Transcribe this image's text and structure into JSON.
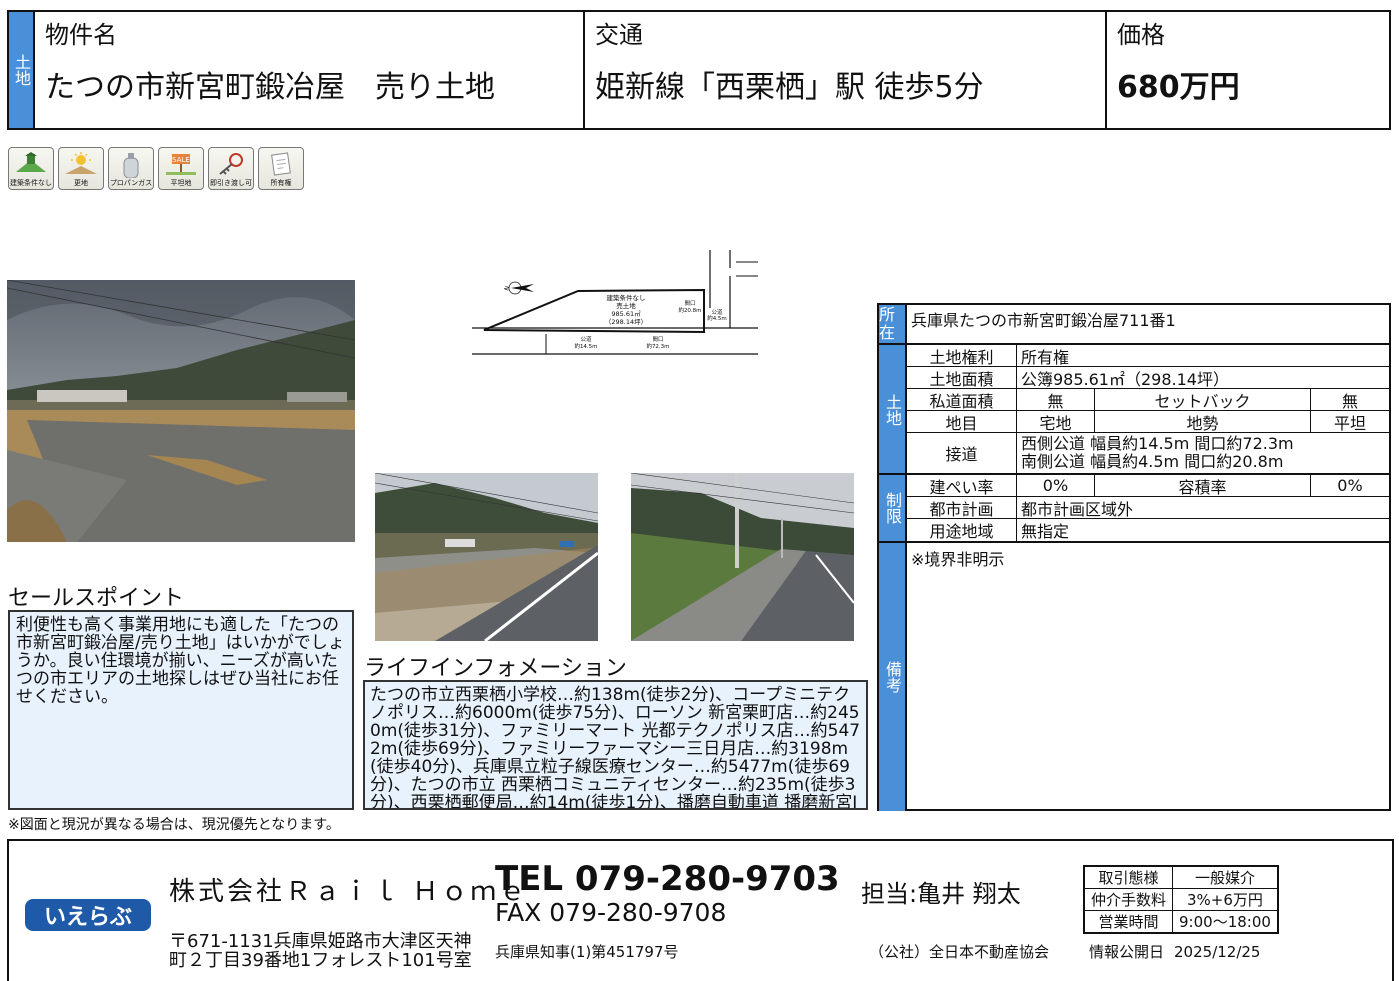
{
  "header": {
    "tag": "土地",
    "name_label": "物件名",
    "name_value": "たつの市新宮町鍛冶屋　売り土地",
    "access_label": "交通",
    "access_value": "姫新線「西栗栖」駅 徒歩5分",
    "price_label": "価格",
    "price_value": "680万円"
  },
  "badges": [
    {
      "icon": "land-icon",
      "label": "建築条件なし"
    },
    {
      "icon": "vacant-land-icon",
      "label": "更地"
    },
    {
      "icon": "gas-cylinder-icon",
      "label": "プロパンガス"
    },
    {
      "icon": "flat-land-sign-icon",
      "label": "平坦地"
    },
    {
      "icon": "key-icon",
      "label": "即引き渡し可"
    },
    {
      "icon": "document-icon",
      "label": "所有権"
    }
  ],
  "plan": {
    "lot_lines": [
      "建築条件なし",
      "売土地",
      "985.61㎡",
      "（298.14坪）"
    ],
    "frontage_top": "間口",
    "frontage_top_val": "約20.8m",
    "road_right": "公道",
    "road_right_val": "約4.5m",
    "road_bottom": "公道",
    "road_bottom_val": "約14.5m",
    "frontage_bottom": "間口",
    "frontage_bottom_val": "約72.3m",
    "north": "N"
  },
  "sales_point": {
    "title": "セールスポイント",
    "text": "利便性も高く事業用地にも適した「たつの市新宮町鍛冶屋/売り土地」はいかがでしょうか。良い住環境が揃い、ニーズが高いたつの市エリアの土地探しはぜひ当社にお任せください。"
  },
  "life_info": {
    "title": "ライフインフォメーション",
    "text": "たつの市立西栗栖小学校…約138m(徒歩2分)、コープミニテクノポリス…約6000m(徒歩75分)、ローソン 新宮栗町店…約2450m(徒歩31分)、ファミリーマート 光都テクノポリス店…約5472m(徒歩69分)、ファミリーファーマシー三日月店…約3198m(徒歩40分)、兵庫県立粒子線医療センター…約5477m(徒歩69分)、たつの市立 西栗栖コミュニティセンター…約235m(徒歩3分)、西栗栖郵便局…約14m(徒歩1分)、播磨自動車道 播磨新宮IC"
  },
  "spec": {
    "location_label": "所在",
    "location_value": "兵庫県たつの市新宮町鍛冶屋711番1",
    "land_label": "土地",
    "rights_label": "土地権利",
    "rights_value": "所有権",
    "area_label": "土地面積",
    "area_value": "公簿985.61㎡（298.14坪）",
    "private_road_label": "私道面積",
    "private_road_value": "無",
    "setback_label": "セットバック",
    "setback_value": "無",
    "category_label": "地目",
    "category_value": "宅地",
    "terrain_label": "地勢",
    "terrain_value": "平坦",
    "road_label": "接道",
    "road_line1": "西側公道 幅員約14.5m 間口約72.3m",
    "road_line2": "南側公道 幅員約4.5m 間口約20.8m",
    "restrict_label": "制限",
    "bcr_label": "建ぺい率",
    "bcr_value": "0%",
    "far_label": "容積率",
    "far_value": "0%",
    "city_plan_label": "都市計画",
    "city_plan_value": "都市計画区域外",
    "zoning_label": "用途地域",
    "zoning_value": "無指定",
    "remarks_label": "備考",
    "remarks_value": "※境界非明示"
  },
  "footnote": "※図面と現況が異なる場合は、現況優先となります。",
  "footer": {
    "logo_text": "いえらぶ",
    "company": "株式会社Ｒａｉｌ Ｈｏｍｅ",
    "address_line1": "〒671-1131兵庫県姫路市大津区天神",
    "address_line2": "町２丁目39番地1フォレスト101号室",
    "tel": "TEL 079-280-9703",
    "fax": "FAX 079-280-9708",
    "license": "兵庫県知事(1)第451797号",
    "staff": "担当:亀井 翔太",
    "association": "（公社）全日本不動産協会",
    "deal_type_label": "取引態様",
    "deal_type_value": "一般媒介",
    "fee_label": "仲介手数料",
    "fee_value": "3%+6万円",
    "hours_label": "営業時間",
    "hours_value": "9:00〜18:00",
    "publish_label": "情報公開日",
    "publish_date": "2025/12/25"
  },
  "colors": {
    "accent_blue": "#4a90d9",
    "box_bg": "#e8f2fc",
    "logo_blue": "#1e5aa8"
  }
}
